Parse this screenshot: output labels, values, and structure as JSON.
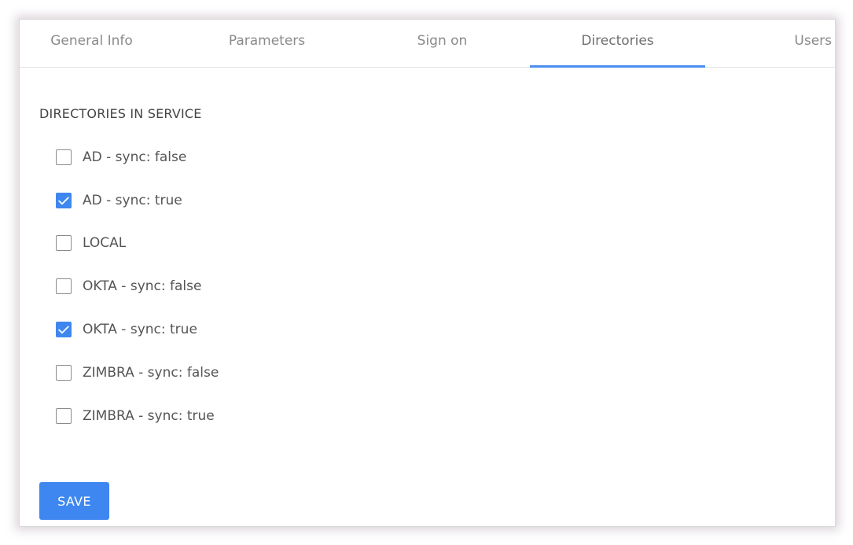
{
  "tabs": [
    {
      "label": "General Info",
      "active": false
    },
    {
      "label": "Parameters",
      "active": false
    },
    {
      "label": "Sign on",
      "active": false
    },
    {
      "label": "Directories",
      "active": true
    },
    {
      "label": "Users",
      "active": false
    }
  ],
  "section": {
    "title": "DIRECTORIES IN SERVICE"
  },
  "directories": [
    {
      "label": "AD - sync: false",
      "checked": false
    },
    {
      "label": "AD - sync: true",
      "checked": true
    },
    {
      "label": "LOCAL",
      "checked": false
    },
    {
      "label": "OKTA - sync: false",
      "checked": false
    },
    {
      "label": "OKTA - sync: true",
      "checked": true
    },
    {
      "label": "ZIMBRA - sync: false",
      "checked": false
    },
    {
      "label": "ZIMBRA - sync: true",
      "checked": false
    }
  ],
  "actions": {
    "save_label": "SAVE"
  },
  "colors": {
    "accent": "#3f87f0",
    "tab_underline": "#4a8ff0"
  }
}
